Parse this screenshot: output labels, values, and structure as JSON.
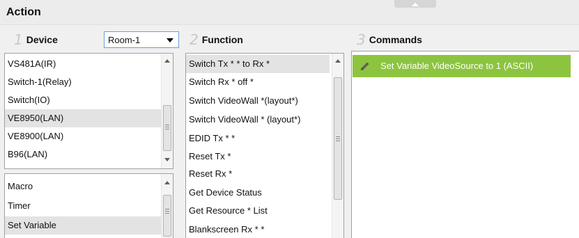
{
  "title": "Action",
  "colors": {
    "accent_green": "#8cc43f",
    "select_border": "#6e9ecf",
    "selected_row": "#e3e3e3"
  },
  "device_panel": {
    "number": "1",
    "title": "Device",
    "room_select": {
      "value": "Room-1"
    },
    "devices": [
      "VS481A(IR)",
      "Switch-1(Relay)",
      "Switch(IO)",
      "VE8950(LAN)",
      "VE8900(LAN)",
      "B96(LAN)"
    ],
    "selected_device": "VE8950(LAN)",
    "extras": [
      "Macro",
      "Timer",
      "Set Variable"
    ],
    "selected_extra": "Set Variable"
  },
  "function_panel": {
    "number": "2",
    "title": "Function",
    "functions": [
      "Switch Tx * * to Rx *",
      "Switch Rx * off *",
      "Switch VideoWall *(layout*)",
      "Switch VideoWall * (layout*)",
      "EDID Tx * *",
      "Reset Tx *",
      "Reset Rx *",
      "Get Device Status",
      "Get Resource * List",
      "Blankscreen Rx * *"
    ],
    "selected_function": "Switch Tx * * to Rx *"
  },
  "commands_panel": {
    "number": "3",
    "title": "Commands",
    "commands": [
      {
        "label": "Set Variable VideoSource to 1 (ASCII)",
        "icon": "pencil-icon"
      }
    ]
  }
}
